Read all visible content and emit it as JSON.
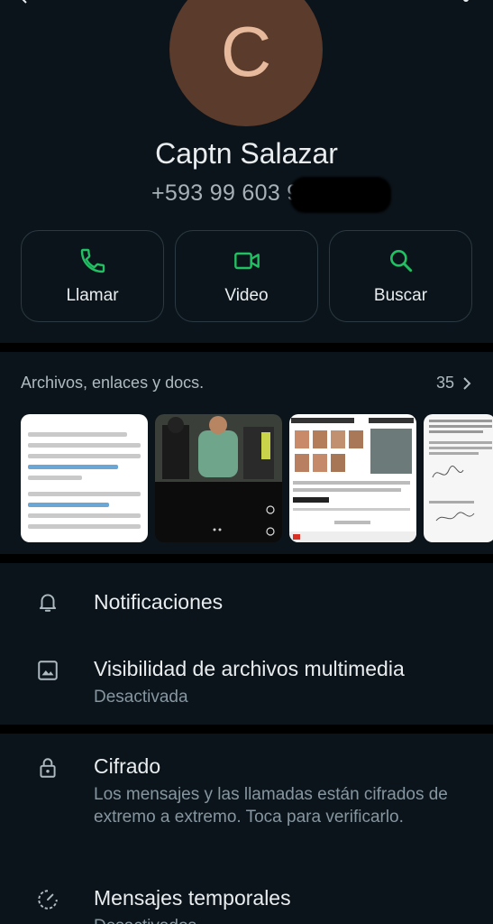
{
  "contact": {
    "avatar_letter": "C",
    "name": "Captn Salazar",
    "phone": "+593 99 603 9"
  },
  "actions": [
    {
      "label": "Llamar",
      "icon": "phone-icon"
    },
    {
      "label": "Video",
      "icon": "video-icon"
    },
    {
      "label": "Buscar",
      "icon": "search-icon"
    }
  ],
  "media": {
    "title": "Archivos, enlaces y docs.",
    "count": "35"
  },
  "settings": {
    "notifications": {
      "title": "Notificaciones",
      "icon": "bell-icon"
    },
    "media_visibility": {
      "title": "Visibilidad de archivos multimedia",
      "subtitle": "Desactivada",
      "icon": "image-icon"
    },
    "encryption": {
      "title": "Cifrado",
      "subtitle": "Los mensajes y las llamadas están cifrados de extremo a extremo. Toca para verificarlo.",
      "icon": "lock-icon"
    },
    "disappearing": {
      "title": "Mensajes temporales",
      "subtitle": "Desactivados",
      "icon": "timer-icon"
    }
  },
  "colors": {
    "accent": "#21c063",
    "background": "#0b141a",
    "avatar_bg": "#5b3b2b"
  }
}
